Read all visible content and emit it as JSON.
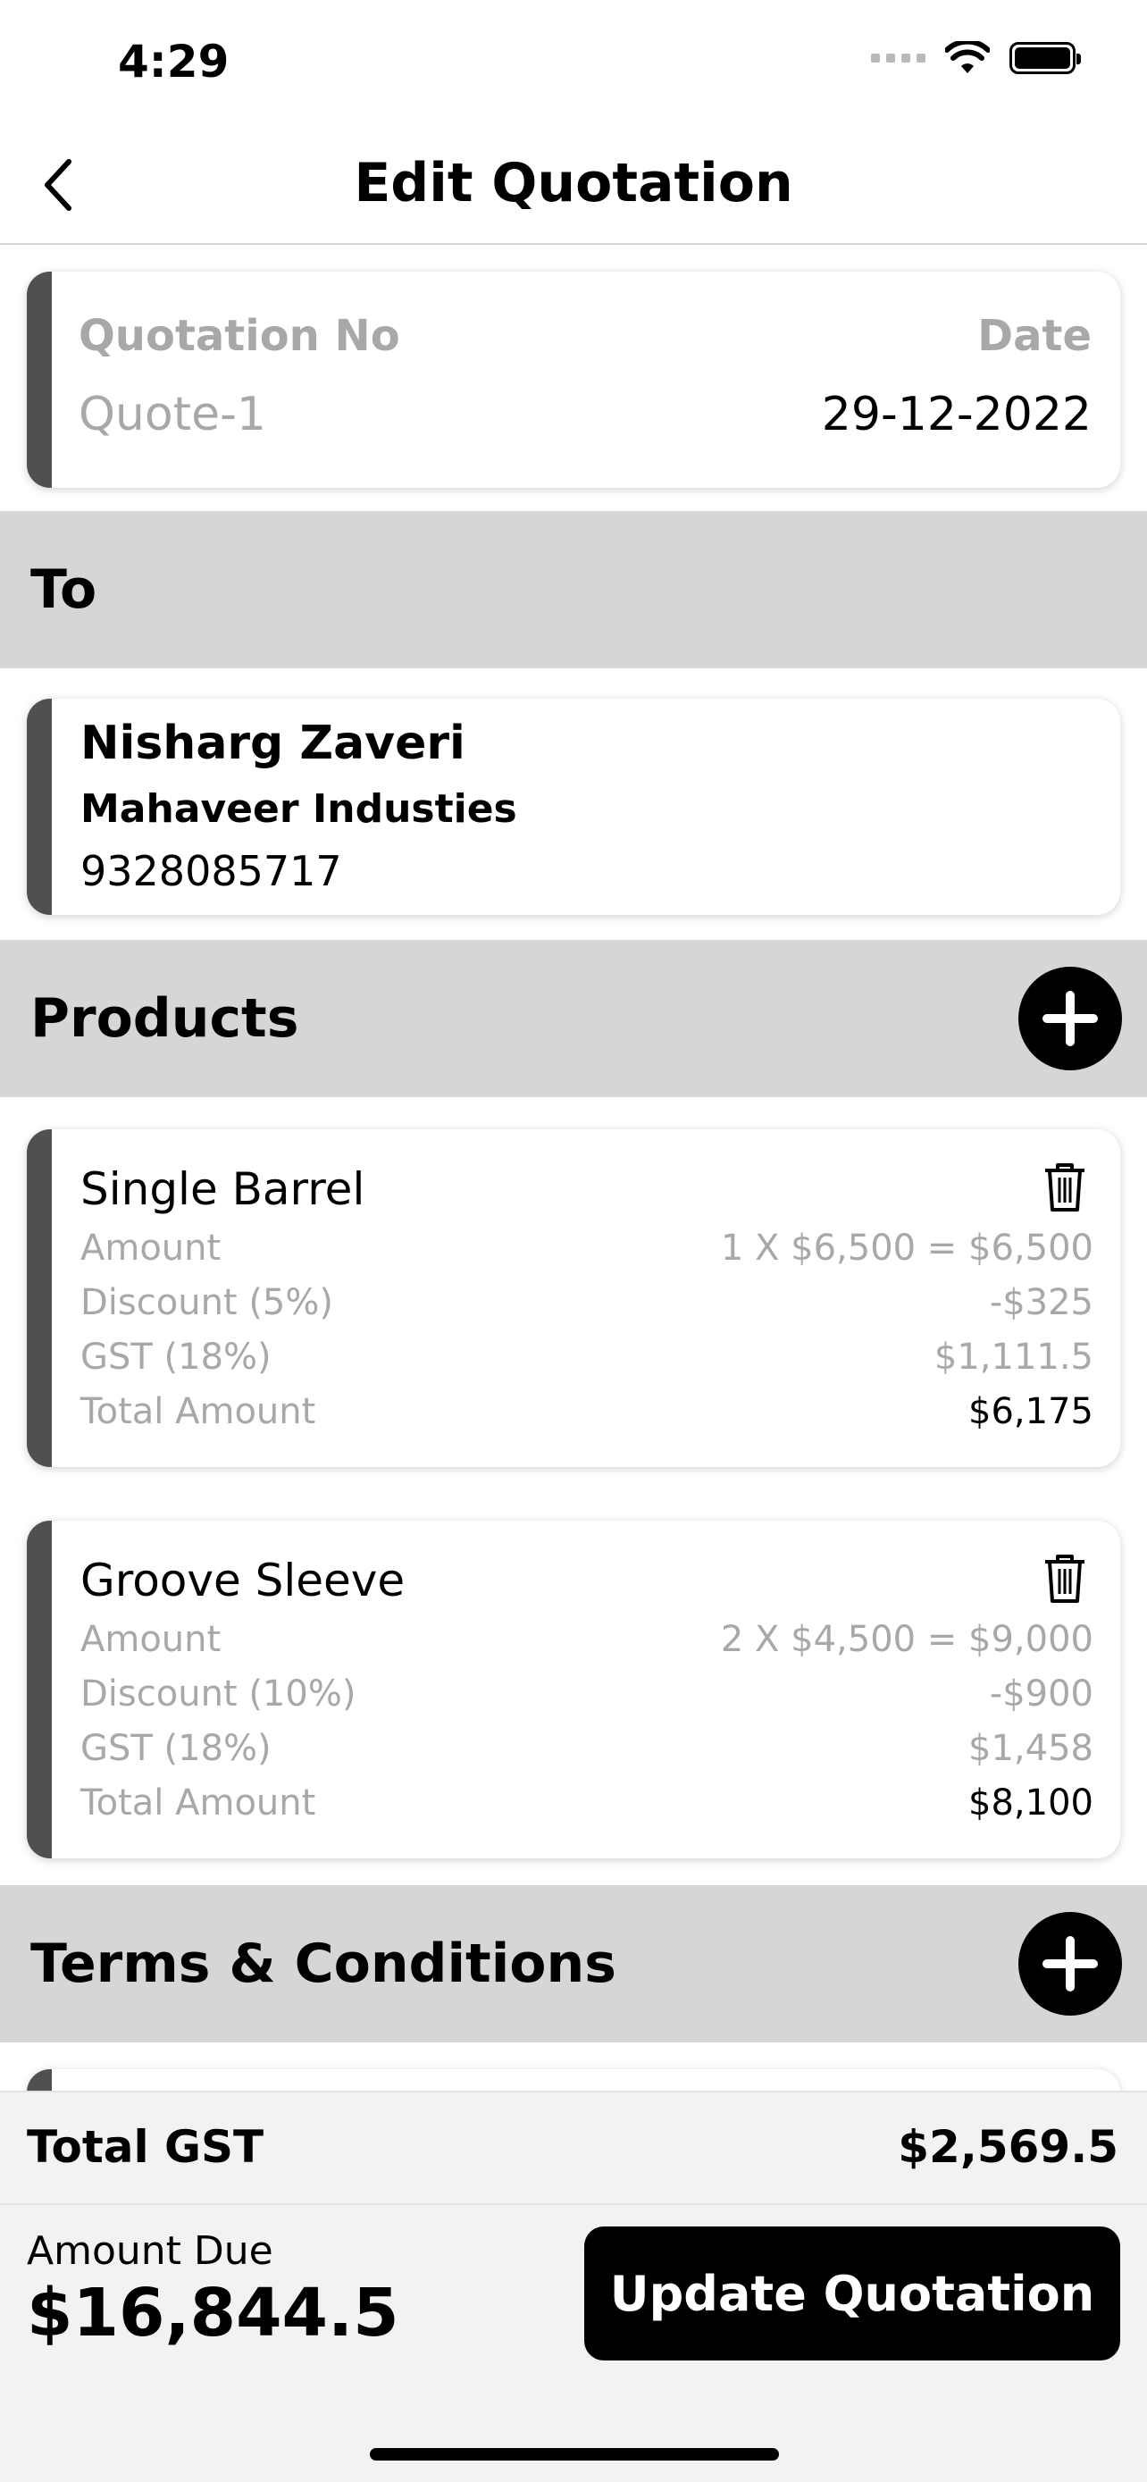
{
  "status_bar": {
    "time": "4:29"
  },
  "nav": {
    "title": "Edit Quotation"
  },
  "quotation": {
    "number_label": "Quotation No",
    "number_value": "Quote-1",
    "date_label": "Date",
    "date_value": "29-12-2022"
  },
  "to_section": {
    "title": "To"
  },
  "customer": {
    "name": "Nisharg Zaveri",
    "company": "Mahaveer Industies",
    "phone": "9328085717"
  },
  "products_section": {
    "title": "Products"
  },
  "products": [
    {
      "name": "Single Barrel",
      "amount_label": "Amount",
      "amount_value": "1 X $6,500 = $6,500",
      "discount_label": "Discount (5%)",
      "discount_value": "-$325",
      "gst_label": "GST (18%)",
      "gst_value": "$1,111.5",
      "total_label": "Total Amount",
      "total_value": "$6,175"
    },
    {
      "name": "Groove Sleeve",
      "amount_label": "Amount",
      "amount_value": "2 X $4,500 = $9,000",
      "discount_label": "Discount (10%)",
      "discount_value": "-$900",
      "gst_label": "GST (18%)",
      "gst_value": "$1,458",
      "total_label": "Total Amount",
      "total_value": "$8,100"
    }
  ],
  "terms_section": {
    "title": "Terms & Conditions"
  },
  "footer": {
    "gst_label": "Total GST",
    "gst_value": "$2,569.5",
    "due_label": "Amount Due",
    "due_value": "$16,844.5",
    "update_label": "Update Quotation"
  },
  "icons": {
    "back": "chevron-left-icon",
    "add": "plus-icon",
    "delete": "trash-icon",
    "wifi": "wifi-icon",
    "battery": "battery-icon"
  }
}
